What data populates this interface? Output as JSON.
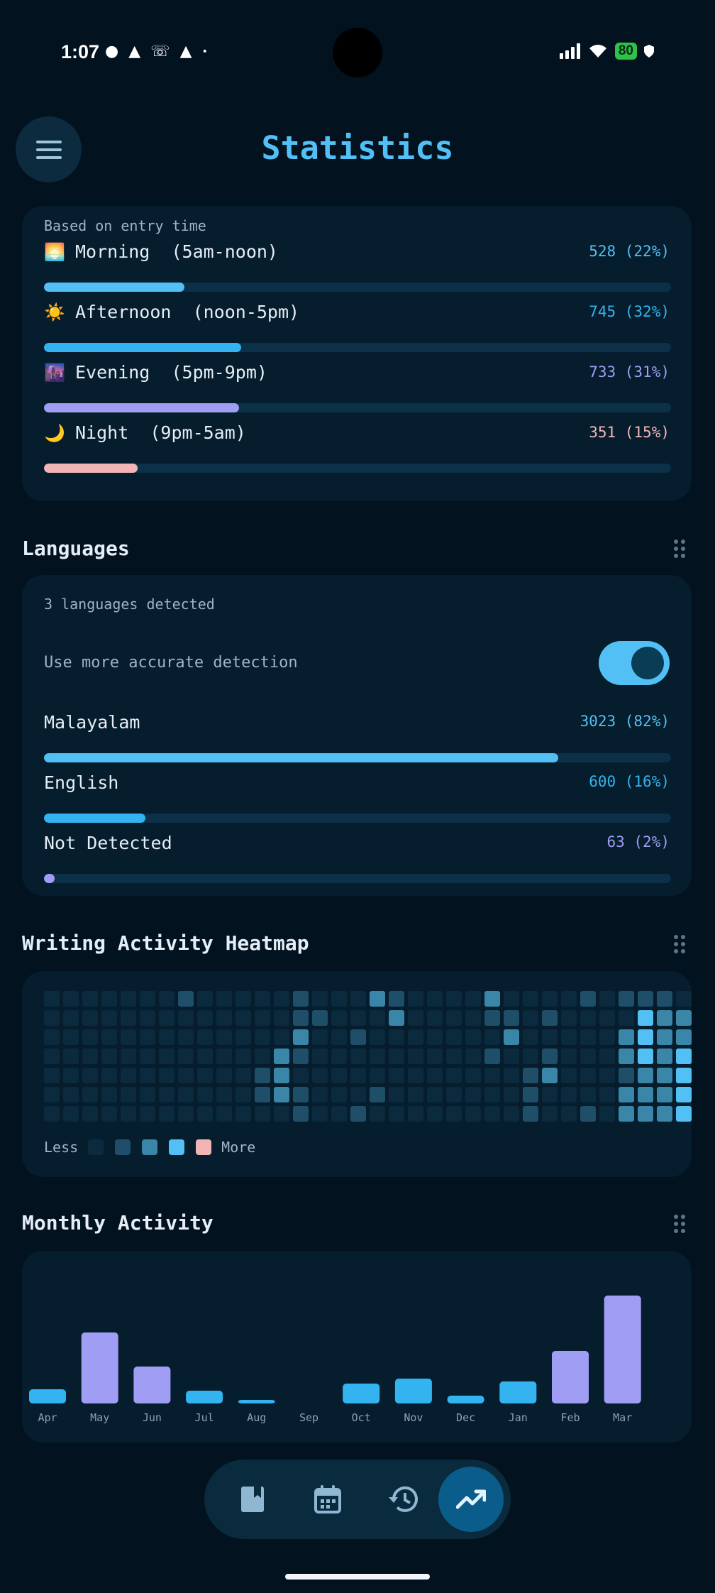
{
  "status": {
    "time": "1:07",
    "battery": "80"
  },
  "header": {
    "title": "Statistics"
  },
  "time_of_day": {
    "caption": "Based on entry time",
    "rows": [
      {
        "emoji": "🌅",
        "label": "Morning  (5am-noon)",
        "value": "528 (22%)",
        "fraction": 0.224,
        "color": "#52c0f5"
      },
      {
        "emoji": "☀️",
        "label": "Afternoon  (noon-5pm)",
        "value": "745 (32%)",
        "fraction": 0.315,
        "color": "#33b4f0"
      },
      {
        "emoji": "🌆",
        "label": "Evening  (5pm-9pm)",
        "value": "733 (31%)",
        "fraction": 0.311,
        "color": "#a09df5"
      },
      {
        "emoji": "🌙",
        "label": "Night  (9pm-5am)",
        "value": "351 (15%)",
        "fraction": 0.149,
        "color": "#f2b5b5"
      }
    ]
  },
  "languages": {
    "title": "Languages",
    "caption": "3 languages detected",
    "toggle_label": "Use more accurate detection",
    "toggle_on": true,
    "rows": [
      {
        "label": "Malayalam",
        "value": "3023 (82%)",
        "fraction": 0.82,
        "color": "#52c0f5"
      },
      {
        "label": "English",
        "value": "600 (16%)",
        "fraction": 0.162,
        "color": "#33b4f0"
      },
      {
        "label": "Not Detected",
        "value": "63 (2%)",
        "fraction": 0.017,
        "color": "#a09df5"
      }
    ]
  },
  "heatmap": {
    "title": "Writing Activity Heatmap",
    "legend_less": "Less",
    "legend_more": "More",
    "legend_colors": [
      "#0b2a3d",
      "#1f4f68",
      "#3a86a8",
      "#52c0f5",
      "#f2b5b5"
    ],
    "levels_by_column": [
      "0000000",
      "0000000",
      "0000000",
      "0000000",
      "0000000",
      "0000000",
      "0000000",
      "1000000",
      "0000000",
      "0000000",
      "0000000",
      "0000110",
      "0002220",
      "1121011",
      "0100000",
      "0000000",
      "0010001",
      "2000010",
      "1200000",
      "0000000",
      "0000000",
      "0000000",
      "0000000",
      "2101000",
      "0120000",
      "0000111",
      "0101200",
      "0000000",
      "1000001",
      "0000000",
      "1022122",
      "1333222",
      "1222222",
      "0223333"
    ]
  },
  "monthly": {
    "title": "Monthly Activity",
    "chart_data": {
      "type": "bar",
      "categories": [
        "Apr",
        "May",
        "Jun",
        "Jul",
        "Aug",
        "Sep",
        "Oct",
        "Nov",
        "Dec",
        "Jan",
        "Feb",
        "Mar"
      ],
      "values": [
        20,
        100,
        52,
        18,
        5,
        0,
        28,
        35,
        11,
        31,
        74,
        152
      ],
      "colors": [
        "#33b4f0",
        "#a09df5",
        "#a09df5",
        "#33b4f0",
        "#33b4f0",
        "#33b4f0",
        "#33b4f0",
        "#33b4f0",
        "#33b4f0",
        "#33b4f0",
        "#a09df5",
        "#a09df5"
      ]
    }
  },
  "nav": {
    "items": [
      "journal-icon",
      "calendar-icon",
      "history-icon",
      "trending-icon"
    ],
    "active": 3
  }
}
